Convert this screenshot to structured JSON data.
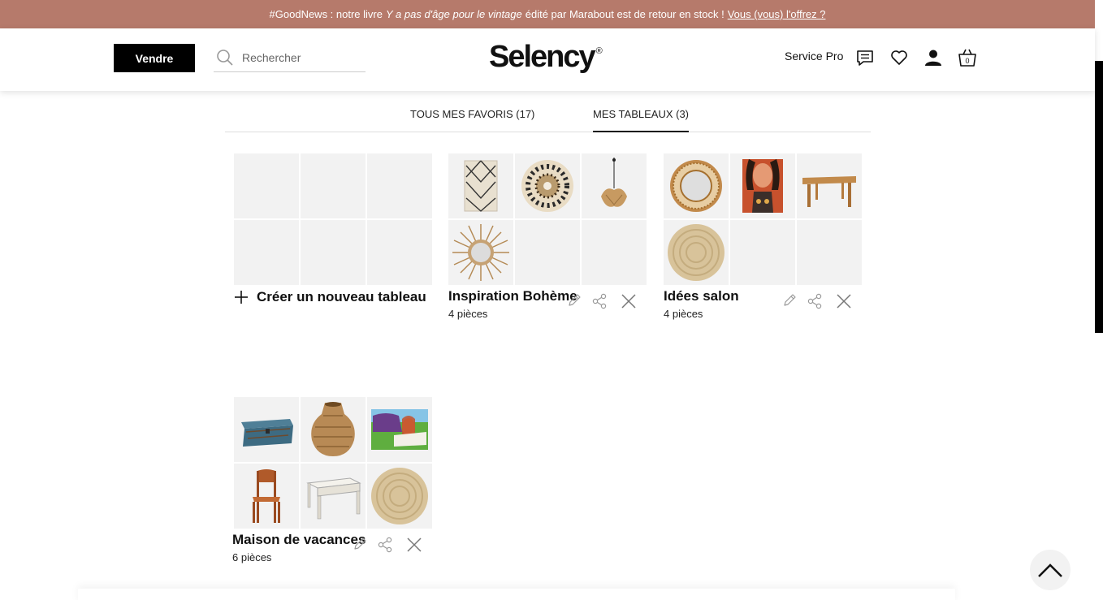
{
  "banner": {
    "prefix": "#GoodNews : notre livre",
    "book_title": "Y a pas d'âge pour le vintage",
    "suffix": "édité par Marabout est de retour en stock !",
    "link": "Vous (vous) l'offrez ?"
  },
  "header": {
    "sell_label": "Vendre",
    "search_placeholder": "Rechercher",
    "logo": "Selency",
    "logo_mark": "®",
    "service_pro": "Service Pro",
    "cart_count": "0"
  },
  "tabs": [
    {
      "label": "TOUS MES FAVORIS (17)",
      "active": false
    },
    {
      "label": "MES TABLEAUX (3)",
      "active": true
    }
  ],
  "create_label": "Créer un nouveau tableau",
  "boards": [
    {
      "title": "Inspiration Bohème",
      "count": "4 pièces",
      "items": [
        "berber-rug",
        "juju-hat",
        "rattan-pendant-lamp",
        "sunburst-mirror",
        "",
        ""
      ]
    },
    {
      "title": "Idées salon",
      "count": "4 pièces",
      "items": [
        "rattan-round-mirror",
        "cat-portrait-painting",
        "wooden-bench",
        "jute-round-rug",
        "",
        ""
      ]
    },
    {
      "title": "Maison de vacances",
      "count": "6 pièces",
      "items": [
        "blue-wooden-chest",
        "wicker-vase",
        "woman-car-painting",
        "bistro-chair",
        "white-wooden-desk",
        "jute-round-rug"
      ]
    }
  ],
  "colors": {
    "banner": "#b67a6b",
    "sell_button": "#000000",
    "placeholder_cell": "#f2f2f2"
  }
}
